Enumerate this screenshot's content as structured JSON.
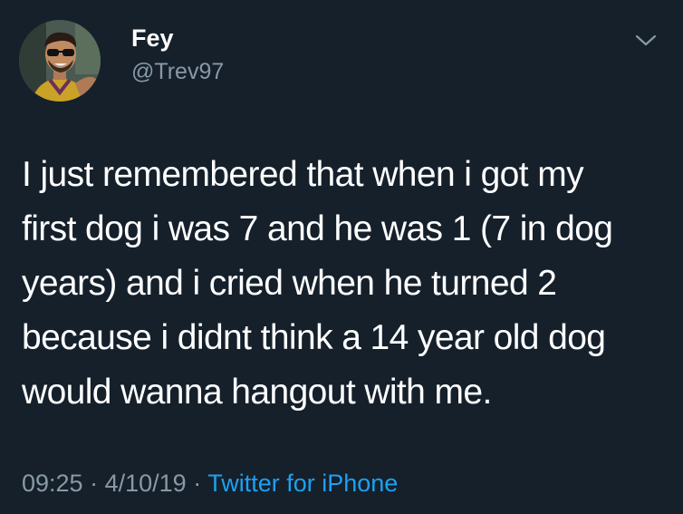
{
  "colors": {
    "background": "#15202b",
    "text_primary": "#ffffff",
    "text_secondary": "#8899a6",
    "link": "#1da1f2"
  },
  "tweet": {
    "author": {
      "display_name": "Fey",
      "handle": "@Trev97",
      "avatar_icon": "profile-photo"
    },
    "menu_icon": "chevron-down-icon",
    "text_lines": [
      "I just remembered that when i got my",
      "first dog i was 7 and he was 1 (7 in dog",
      "years) and i cried when he turned 2",
      "because i didnt think a 14 year old dog",
      "would wanna hangout with me."
    ],
    "time": "09:25",
    "date": "4/10/19",
    "separator": "·",
    "source": "Twitter for iPhone"
  }
}
